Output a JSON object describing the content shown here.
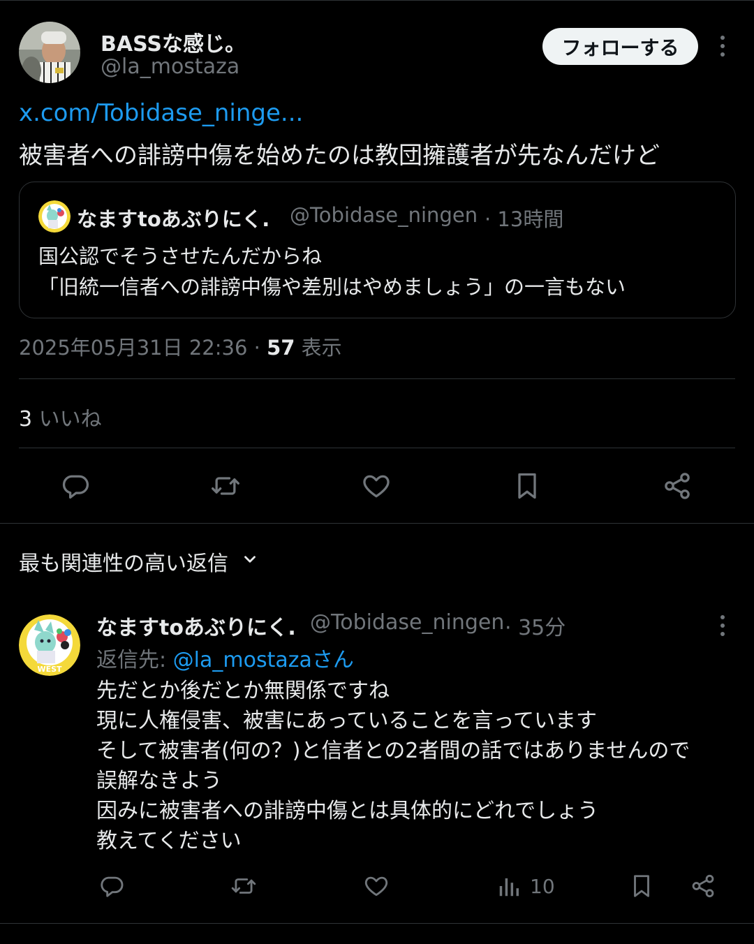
{
  "tweet": {
    "author_name": "BASSな感じ。",
    "author_handle": "@la_mostaza",
    "follow_label": "フォローする",
    "link_text": "x.com/Tobidase_ninge...",
    "text": "被害者への誹謗中傷を始めたのは教団擁護者が先なんだけど",
    "quote": {
      "author_name": "なますtoあぶりにく.",
      "author_handle": "@Tobidase_ningen",
      "time": "· 13時間",
      "text": "国公認でそうさせたんだからね\n「旧統一信者への誹謗中傷や差別はやめましょう」の一言もない"
    },
    "timestamp": "2025年05月31日 22:36 · ",
    "views_count": "57",
    "views_label": " 表示",
    "likes_count": "3",
    "likes_label": " いいね"
  },
  "actions": {
    "reply_icon": "reply-icon",
    "retweet_icon": "retweet-icon",
    "like_icon": "heart-icon",
    "bookmark_icon": "bookmark-icon",
    "share_icon": "share-icon"
  },
  "replies_section": {
    "sort_label": "最も関連性の高い返信"
  },
  "reply": {
    "author_name": "なますtoあぶりにく.",
    "author_handle": "@Tobidase_ningen",
    "time": "· 35分",
    "reply_to_prefix": "返信先: ",
    "reply_to_mention": "@la_mostazaさん",
    "text": "先だとか後だとか無関係ですね\n現に人権侵害、被害にあっていることを言っています\nそして被害者(何の？)と信者との2者間の話ではありませんので\n誤解なきよう\n因みに被害者への誹謗中傷とは具体的にどれでしょう\n教えてください",
    "views_count": "10",
    "avatar_badge": "WEST"
  },
  "colors": {
    "background": "#000000",
    "text_primary": "#e7e9ea",
    "text_secondary": "#71767b",
    "link": "#1d9bf0",
    "border": "#2f3336",
    "follow_bg": "#eff3f4"
  }
}
